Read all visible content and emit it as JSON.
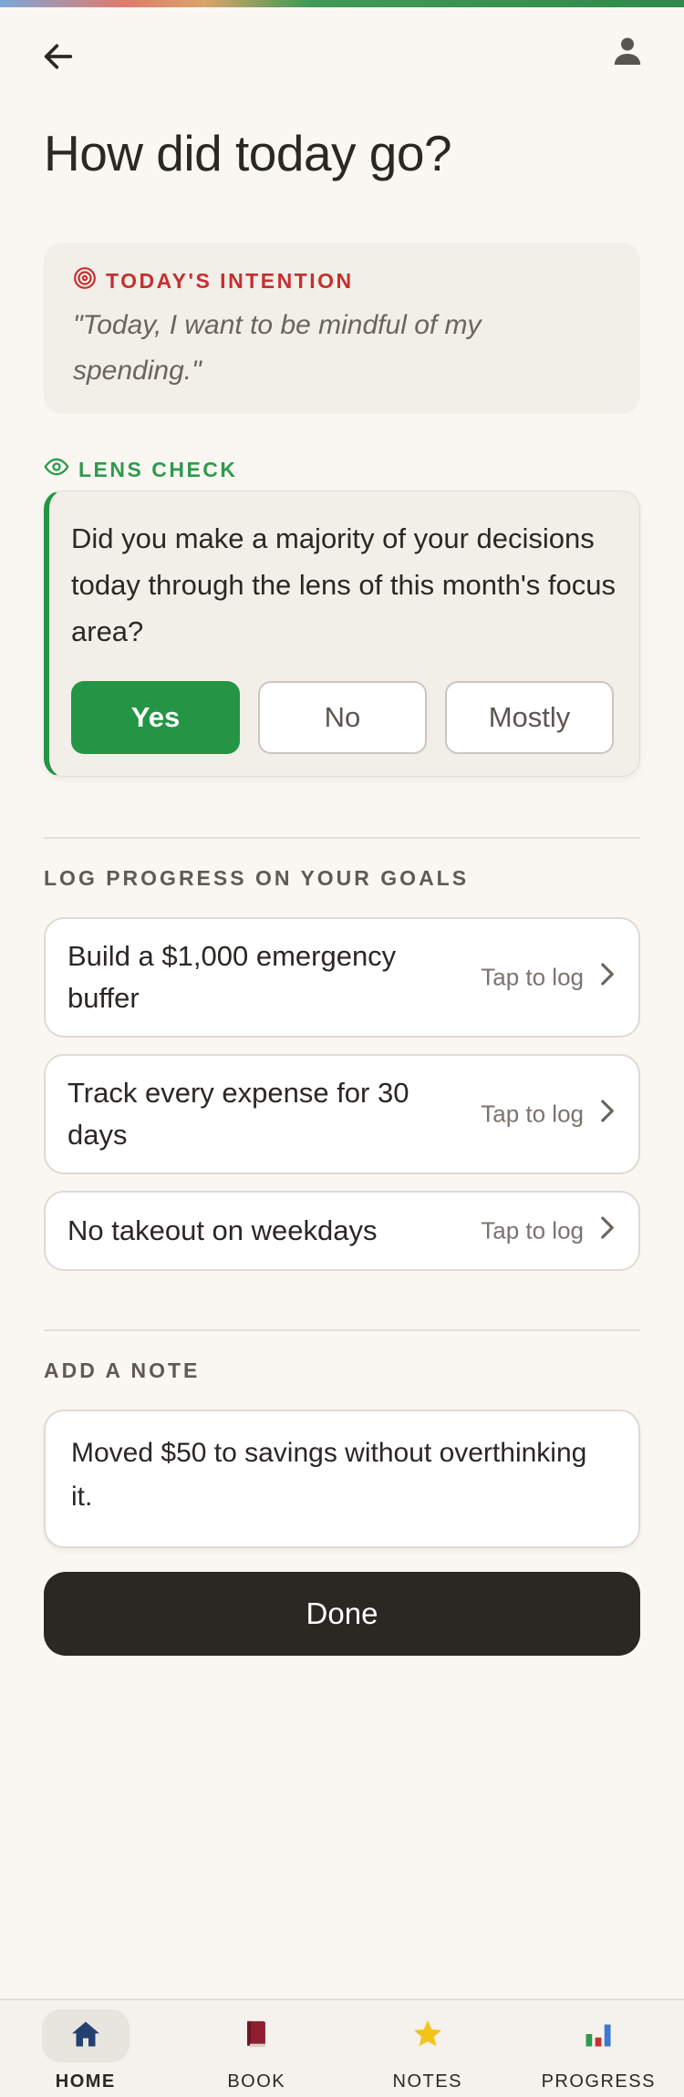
{
  "header": {
    "back_icon": "arrow-left-icon",
    "profile_icon": "person-icon"
  },
  "title": "How did today go?",
  "intention": {
    "icon": "target-icon",
    "label": "TODAY'S INTENTION",
    "text": "\"Today, I want to be mindful of my spending.\"",
    "color": "#c62f2f"
  },
  "lens_check": {
    "icon": "eye-icon",
    "label": "LENS CHECK",
    "question": "Did you make a majority of your decisions today through the lens of this month's focus area?",
    "options": [
      {
        "label": "Yes",
        "selected": true
      },
      {
        "label": "No",
        "selected": false
      },
      {
        "label": "Mostly",
        "selected": false
      }
    ],
    "accent_color": "#239544"
  },
  "goals": {
    "label": "LOG PROGRESS ON YOUR GOALS",
    "items": [
      {
        "title": "Build a $1,000 emergency buffer",
        "action": "Tap to log"
      },
      {
        "title": "Track every expense for 30 days",
        "action": "Tap to log"
      },
      {
        "title": "No takeout on weekdays",
        "action": "Tap to log"
      }
    ]
  },
  "note": {
    "label": "ADD A NOTE",
    "value": "Moved $50 to savings without overthinking it."
  },
  "done_label": "Done",
  "nav": {
    "items": [
      {
        "label": "HOME",
        "icon": "home-icon",
        "active": true
      },
      {
        "label": "BOOK",
        "icon": "book-icon",
        "active": false
      },
      {
        "label": "NOTES",
        "icon": "star-icon",
        "active": false
      },
      {
        "label": "PROGRESS",
        "icon": "bar-chart-icon",
        "active": false
      }
    ]
  }
}
